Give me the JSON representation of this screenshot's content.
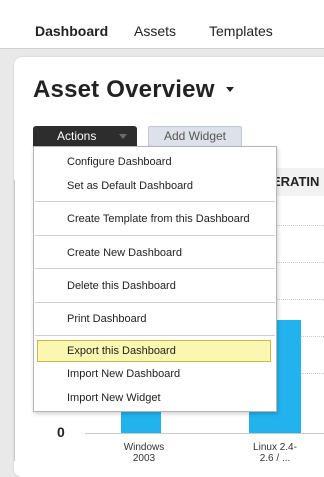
{
  "nav": {
    "items": [
      {
        "label": "Dashboard",
        "active": true
      },
      {
        "label": "Assets",
        "active": false
      },
      {
        "label": "Templates",
        "active": false
      }
    ]
  },
  "page": {
    "title": "Asset Overview"
  },
  "toolbar": {
    "actions_label": "Actions",
    "add_widget_label": "Add Widget"
  },
  "menu": {
    "items": [
      {
        "label": "Configure Dashboard"
      },
      {
        "label": "Set as Default Dashboard"
      },
      {
        "label": "Create Template from this Dashboard"
      },
      {
        "label": "Create New Dashboard"
      },
      {
        "label": "Delete this Dashboard"
      },
      {
        "label": "Print Dashboard"
      },
      {
        "label": "Export this Dashboard",
        "highlighted": true
      },
      {
        "label": "Import New Dashboard"
      },
      {
        "label": "Import New Widget"
      }
    ]
  },
  "chart": {
    "header_text": "ERATIN",
    "y_zero_label": "0",
    "x_labels": [
      {
        "line1": "Windows",
        "line2": "2003"
      },
      {
        "line1": "Linux 2.4-",
        "line2": "2.6 / ..."
      }
    ],
    "bar_color": "#22b3ee"
  },
  "colors": {
    "menu_highlight": "#fbf6b0",
    "actions_button_bg": "#2d2d2d",
    "add_widget_bg": "#dde2ea"
  }
}
